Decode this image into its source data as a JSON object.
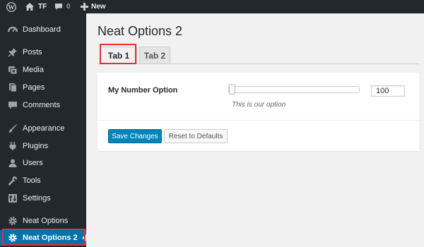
{
  "admin_bar": {
    "site_name": "TF",
    "comments_count": "0",
    "new_label": "New",
    "icons": [
      "wordpress-icon",
      "home-icon",
      "comment-icon",
      "plus-icon"
    ]
  },
  "sidebar": {
    "items": [
      {
        "label": "Dashboard",
        "icon": "dashboard-icon"
      },
      {
        "label": "Posts",
        "icon": "pin-icon"
      },
      {
        "label": "Media",
        "icon": "media-icon"
      },
      {
        "label": "Pages",
        "icon": "pages-icon"
      },
      {
        "label": "Comments",
        "icon": "comment-icon"
      },
      {
        "label": "Appearance",
        "icon": "brush-icon"
      },
      {
        "label": "Plugins",
        "icon": "plug-icon"
      },
      {
        "label": "Users",
        "icon": "user-icon"
      },
      {
        "label": "Tools",
        "icon": "wrench-icon"
      },
      {
        "label": "Settings",
        "icon": "settings-icon"
      },
      {
        "label": "Neat Options",
        "icon": "gear-icon"
      },
      {
        "label": "Neat Options 2",
        "icon": "gear-icon",
        "current": true
      }
    ]
  },
  "page": {
    "title": "Neat Options 2",
    "tabs": [
      {
        "label": "Tab 1",
        "active": true
      },
      {
        "label": "Tab 2",
        "active": false
      }
    ]
  },
  "option": {
    "label": "My Number Option",
    "slider_value_fraction": 0.0,
    "value": "100",
    "description": "This is our option"
  },
  "buttons": {
    "save": "Save Changes",
    "reset": "Reset to Defaults"
  },
  "colors": {
    "admin_dark": "#23282d",
    "accent_blue": "#0085ba",
    "current_menu": "#0073aa",
    "highlight_red": "#dd3333"
  }
}
